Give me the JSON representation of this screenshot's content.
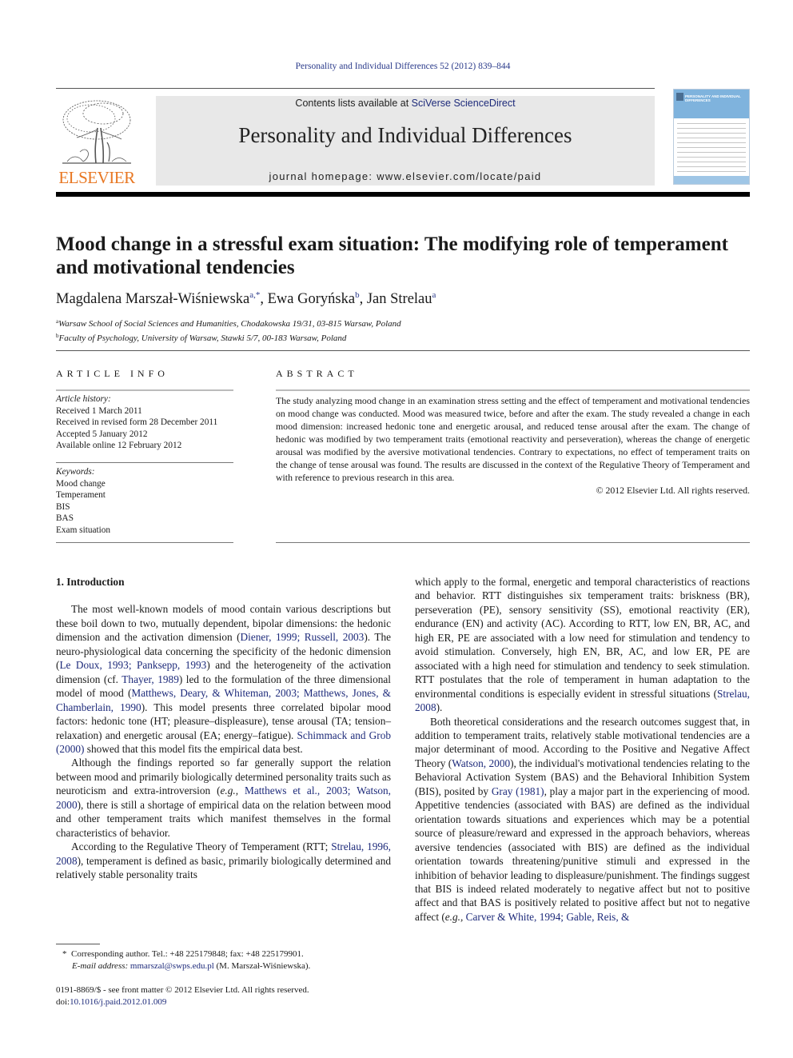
{
  "header": {
    "journal_ref": "Personality and Individual Differences 52 (2012) 839–844",
    "contents_prefix": "Contents lists available at ",
    "contents_link": "SciVerse ScienceDirect",
    "journal_title": "Personality and Individual Differences",
    "homepage": "journal homepage: www.elsevier.com/locate/paid",
    "publisher_logo_text": "ELSEVIER",
    "cover_title": "PERSONALITY AND INDIVIDUAL DIFFERENCES",
    "brand_color": "#e87722",
    "link_color": "#1d2a7a"
  },
  "article": {
    "title": "Mood change in a stressful exam situation: The modifying role of temperament and motivational tendencies",
    "authors": [
      {
        "name": "Magdalena Marszał-Wiśniewska",
        "sup": "a,*"
      },
      {
        "name": "Ewa Goryńska",
        "sup": "b"
      },
      {
        "name": "Jan Strelau",
        "sup": "a"
      }
    ],
    "affiliations": [
      {
        "mark": "a",
        "text": "Warsaw School of Social Sciences and Humanities, Chodakowska 19/31, 03-815 Warsaw, Poland"
      },
      {
        "mark": "b",
        "text": "Faculty of Psychology, University of Warsaw, Stawki 5/7, 00-183 Warsaw, Poland"
      }
    ]
  },
  "article_info": {
    "label": "ARTICLE INFO",
    "history_heading": "Article history:",
    "history": [
      "Received 1 March 2011",
      "Received in revised form 28 December 2011",
      "Accepted 5 January 2012",
      "Available online 12 February 2012"
    ],
    "keywords_heading": "Keywords:",
    "keywords": [
      "Mood change",
      "Temperament",
      "BIS",
      "BAS",
      "Exam situation"
    ]
  },
  "abstract": {
    "label": "ABSTRACT",
    "text": "The study analyzing mood change in an examination stress setting and the effect of temperament and motivational tendencies on mood change was conducted. Mood was measured twice, before and after the exam. The study revealed a change in each mood dimension: increased hedonic tone and energetic arousal, and reduced tense arousal after the exam. The change of hedonic was modified by two temperament traits (emotional reactivity and perseveration), whereas the change of energetic arousal was modified by the aversive motivational tendencies. Contrary to expectations, no effect of temperament traits on the change of tense arousal was found. The results are discussed in the context of the Regulative Theory of Temperament and with reference to previous research in this area.",
    "copyright": "© 2012 Elsevier Ltd. All rights reserved."
  },
  "body": {
    "section_heading": "1. Introduction",
    "p1": [
      {
        "t": "The most well-known models of mood contain various descriptions but these boil down to two, mutually dependent, bipolar dimensions: the hedonic dimension and the activation dimension ("
      },
      {
        "l": "Diener, 1999; Russell, 2003"
      },
      {
        "t": "). The neuro-physiological data concerning the specificity of the hedonic dimension ("
      },
      {
        "l": "Le Doux, 1993; Panksepp, 1993"
      },
      {
        "t": ") and the heterogeneity of the activation dimension (cf. "
      },
      {
        "l": "Thayer, 1989"
      },
      {
        "t": ") led to the formulation of the three dimensional model of mood ("
      },
      {
        "l": "Matthews, Deary, & Whiteman, 2003; Matthews, Jones, & Chamberlain, 1990"
      },
      {
        "t": "). This model presents three correlated bipolar mood factors: hedonic tone (HT; pleasure–displeasure), tense arousal (TA; tension–relaxation) and energetic arousal (EA; energy–fatigue). "
      },
      {
        "l": "Schimmack and Grob (2000)"
      },
      {
        "t": " showed that this model fits the empirical data best."
      }
    ],
    "p2": [
      {
        "t": "Although the findings reported so far generally support the relation between mood and primarily biologically determined personality traits such as neuroticism and extra-introversion ("
      },
      {
        "i": "e.g.,"
      },
      {
        "t": " "
      },
      {
        "l": "Matthews et al., 2003; Watson, 2000"
      },
      {
        "t": "), there is still a shortage of empirical data on the relation between mood and other temperament traits which manifest themselves in the formal characteristics of behavior."
      }
    ],
    "p3": [
      {
        "t": "According to the Regulative Theory of Temperament (RTT; "
      },
      {
        "l": "Strelau, 1996, 2008"
      },
      {
        "t": "), temperament is defined as basic, primarily biologically determined and relatively stable personality traits which apply to the formal, energetic and temporal characteristics of reactions and behavior. RTT distinguishes six temperament traits: briskness (BR), perseveration (PE), sensory sensitivity (SS), emotional reactivity (ER), endurance (EN) and activity (AC). According to RTT, low EN, BR, AC, and high ER, PE are associated with a low need for stimulation and tendency to avoid stimulation. Conversely, high EN, BR, AC, and low ER, PE are associated with a high need for stimulation and tendency to seek stimulation. RTT postulates that the role of temperament in human adaptation to the environmental conditions is especially evident in stressful situations ("
      },
      {
        "l": "Strelau, 2008"
      },
      {
        "t": ")."
      }
    ],
    "p4": [
      {
        "t": "Both theoretical considerations and the research outcomes suggest that, in addition to temperament traits, relatively stable motivational tendencies are a major determinant of mood. According to the Positive and Negative Affect Theory ("
      },
      {
        "l": "Watson, 2000"
      },
      {
        "t": "), the individual's motivational tendencies relating to the Behavioral Activation System (BAS) and the Behavioral Inhibition System (BIS), posited by "
      },
      {
        "l": "Gray (1981)"
      },
      {
        "t": ", play a major part in the experiencing of mood. Appetitive tendencies (associated with BAS) are defined as the individual orientation towards situations and experiences which may be a potential source of pleasure/reward and expressed in the approach behaviors, whereas aversive tendencies (associated with BIS) are defined as the individual orientation towards threatening/punitive stimuli and expressed in the inhibition of behavior leading to displeasure/punishment. The findings suggest that BIS is indeed related moderately to negative affect but not to positive affect and that BAS is positively related to positive affect but not to negative affect ("
      },
      {
        "i": "e.g.,"
      },
      {
        "t": " "
      },
      {
        "l": "Carver & White, 1994; Gable, Reis, &"
      }
    ]
  },
  "footnotes": {
    "star": "*",
    "corresponding": "Corresponding author. Tel.: +48 225179848; fax: +48 225179901.",
    "email_label": "E-mail address:",
    "email": "mmarszal@swps.edu.pl",
    "email_suffix": " (M. Marszał-Wiśniewska).",
    "issn_line": "0191-8869/$ - see front matter © 2012 Elsevier Ltd. All rights reserved.",
    "doi_prefix": "doi:",
    "doi": "10.1016/j.paid.2012.01.009"
  }
}
